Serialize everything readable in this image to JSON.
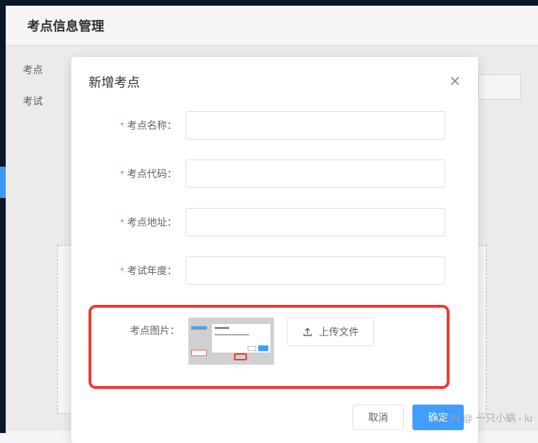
{
  "page": {
    "title": "考点信息管理",
    "filter_labels": [
      "考点",
      "考试"
    ]
  },
  "modal": {
    "title": "新增考点",
    "fields": {
      "name_label": "考点名称：",
      "code_label": "考点代码：",
      "address_label": "考点地址：",
      "year_label": "考试年度：",
      "image_label": "考点图片："
    },
    "upload_button": "上传文件",
    "cancel": "取消",
    "confirm": "确定"
  },
  "watermark": "CSDN @ 一只小蜗 - lu"
}
